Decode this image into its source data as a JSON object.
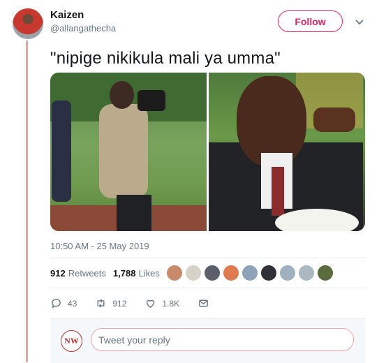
{
  "tweet": {
    "user_name": "Kaizen",
    "user_handle": "@allangathecha",
    "follow_label": "Follow",
    "text": "\"nipige nikikula mali ya umma\"",
    "timestamp": "10:50 AM - 25 May 2019",
    "retweets_count": "912",
    "retweets_label": "Retweets",
    "likes_count": "1,788",
    "likes_label": "Likes",
    "actions": {
      "reply_count": "43",
      "retweet_count": "912",
      "like_count": "1.8K"
    }
  },
  "reply": {
    "placeholder": "Tweet your reply",
    "avatar_text": "NW"
  },
  "colors": {
    "accent": "#e0245e",
    "thread_line": "#e8a39b",
    "muted_text": "#657786"
  }
}
